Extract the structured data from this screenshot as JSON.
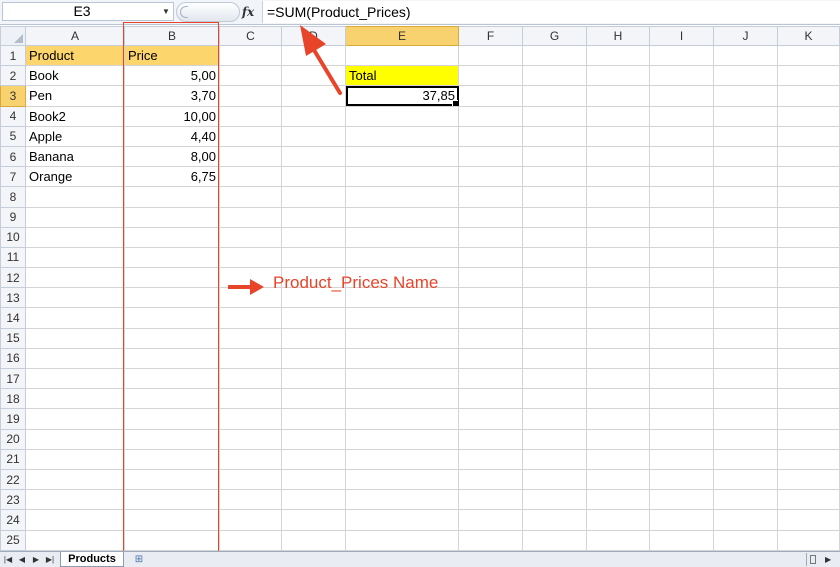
{
  "formula_bar": {
    "name_box": "E3",
    "fx_label": "fx",
    "formula": "=SUM(Product_Prices)"
  },
  "columns": [
    "A",
    "B",
    "C",
    "D",
    "E",
    "F",
    "G",
    "H",
    "I",
    "J",
    "K"
  ],
  "active_column": "E",
  "active_row": 3,
  "rows": [
    {
      "num": "1",
      "A": "Product",
      "B": "Price",
      "E": ""
    },
    {
      "num": "2",
      "A": "Book",
      "B": "5,00",
      "E": "Total"
    },
    {
      "num": "3",
      "A": "Pen",
      "B": "3,70",
      "E": "37,85"
    },
    {
      "num": "4",
      "A": "Book2",
      "B": "10,00",
      "E": ""
    },
    {
      "num": "5",
      "A": "Apple",
      "B": "4,40",
      "E": ""
    },
    {
      "num": "6",
      "A": "Banana",
      "B": "8,00",
      "E": ""
    },
    {
      "num": "7",
      "A": "Orange",
      "B": "6,75",
      "E": ""
    },
    {
      "num": "8"
    },
    {
      "num": "9"
    },
    {
      "num": "10"
    },
    {
      "num": "11"
    },
    {
      "num": "12"
    },
    {
      "num": "13"
    },
    {
      "num": "14"
    },
    {
      "num": "15"
    },
    {
      "num": "16"
    },
    {
      "num": "17"
    },
    {
      "num": "18"
    },
    {
      "num": "19"
    },
    {
      "num": "20"
    },
    {
      "num": "21"
    },
    {
      "num": "22"
    },
    {
      "num": "23"
    },
    {
      "num": "24"
    },
    {
      "num": "25"
    }
  ],
  "sheet_tabs": [
    "Products"
  ],
  "annotation": {
    "label": "Product_Prices Name",
    "color": "#e8442a"
  },
  "colors": {
    "header_fill": "#fdd56d",
    "total_fill": "#ffff00",
    "active_header": "#f7d26e"
  }
}
